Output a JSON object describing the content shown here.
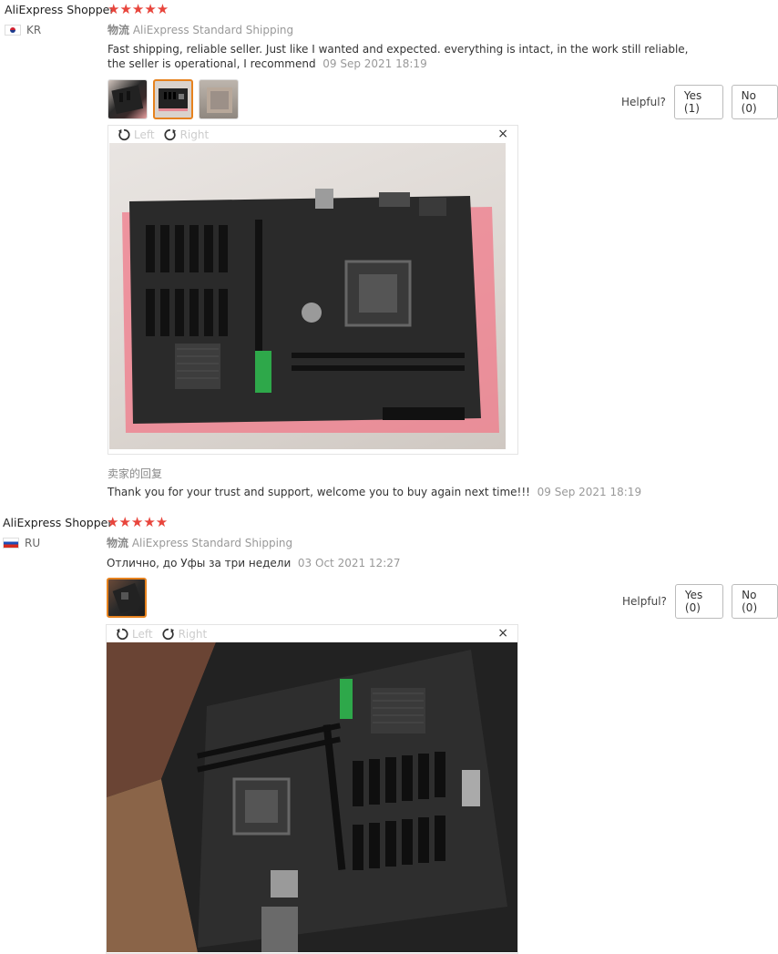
{
  "reviews": [
    {
      "author": "AliExpress Shopper",
      "stars": "★★★★★",
      "country": "KR",
      "shipping_label": "物流",
      "shipping_method": "AliExpress Standard Shipping",
      "text": "Fast shipping, reliable seller. Just like I wanted and expected. everything is intact, in the work still reliable, the seller is operational, I recommend",
      "date": "09 Sep 2021 18:19",
      "helpful_label": "Helpful?",
      "yes_label": "Yes (1)",
      "no_label": "No (0)",
      "viewer": {
        "left_label": "Left",
        "right_label": "Right",
        "close_label": "×"
      },
      "seller_reply_title": "卖家的回复",
      "seller_reply_text": "Thank you for your trust and support, welcome you to buy again next time!!!",
      "seller_reply_date": "09 Sep 2021 18:19"
    },
    {
      "author": "AliExpress Shopper",
      "stars": "★★★★★",
      "country": "RU",
      "shipping_label": "物流",
      "shipping_method": "AliExpress Standard Shipping",
      "text": "Отлично, до Уфы за три недели",
      "date": "03 Oct 2021 12:27",
      "helpful_label": "Helpful?",
      "yes_label": "Yes (0)",
      "no_label": "No (0)",
      "viewer": {
        "left_label": "Left",
        "right_label": "Right",
        "close_label": "×"
      }
    }
  ],
  "colors": {
    "star": "#e8453c",
    "active_thumb": "#e6821e",
    "muted": "#999999"
  }
}
